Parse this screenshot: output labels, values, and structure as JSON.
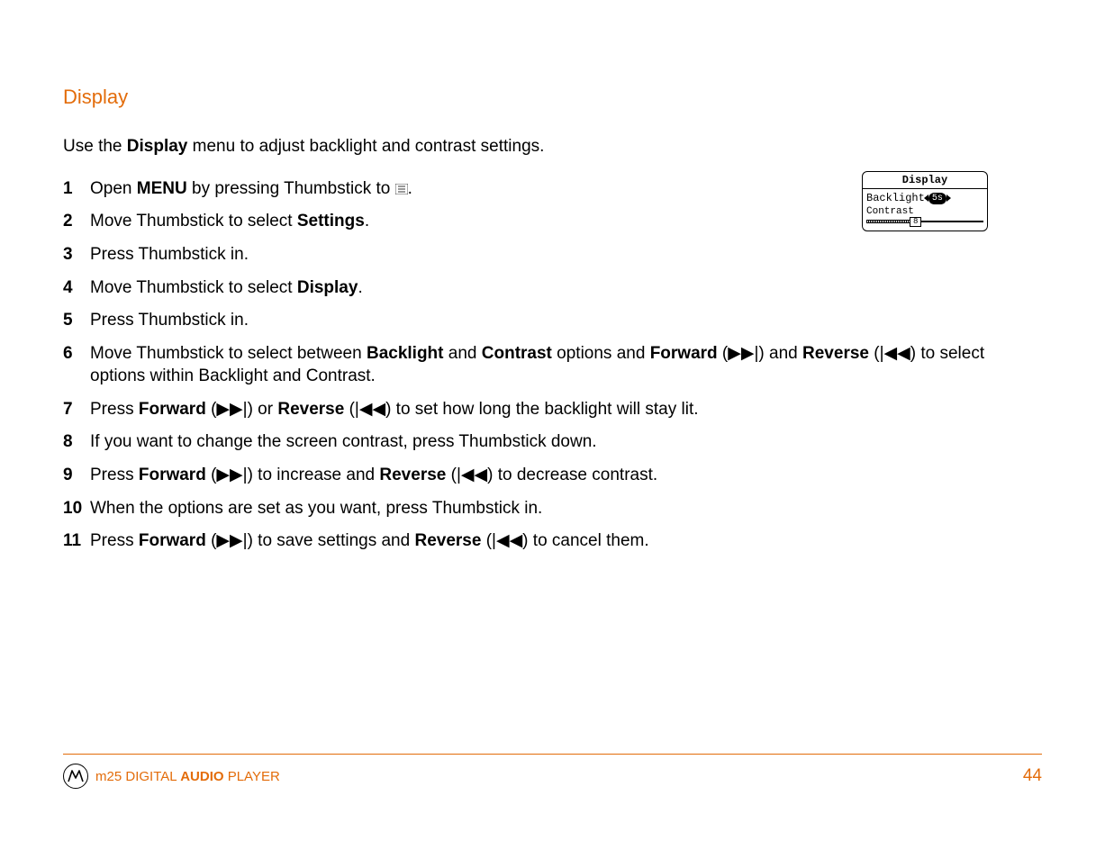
{
  "heading": "Display",
  "intro": {
    "pre": "Use the ",
    "bold": "Display",
    "post": " menu to adjust backlight and contrast settings."
  },
  "steps": [
    {
      "n": "1",
      "parts": [
        "Open ",
        {
          "b": "MENU"
        },
        " by pressing Thumbstick to ",
        {
          "icon": "menu"
        },
        "."
      ]
    },
    {
      "n": "2",
      "parts": [
        "Move Thumbstick to select ",
        {
          "b": "Settings"
        },
        "."
      ]
    },
    {
      "n": "3",
      "parts": [
        "Press Thumbstick in."
      ]
    },
    {
      "n": "4",
      "parts": [
        "Move Thumbstick to select ",
        {
          "b": "Display"
        },
        "."
      ]
    },
    {
      "n": "5",
      "parts": [
        "Press Thumbstick in."
      ]
    },
    {
      "n": "6",
      "parts": [
        "Move Thumbstick to select between ",
        {
          "b": "Backlight"
        },
        " and ",
        {
          "b": "Contrast"
        },
        " options and ",
        {
          "b": "Forward"
        },
        " (▶▶|) and ",
        {
          "b": "Reverse"
        },
        " (|◀◀) to select options within Backlight and Contrast."
      ]
    },
    {
      "n": "7",
      "parts": [
        "Press ",
        {
          "b": "Forward"
        },
        " (▶▶|) or ",
        {
          "b": "Reverse"
        },
        " (|◀◀) to set how long the backlight will stay lit."
      ]
    },
    {
      "n": "8",
      "parts": [
        "If you want to change the screen contrast, press Thumbstick down."
      ]
    },
    {
      "n": "9",
      "parts": [
        "Press ",
        {
          "b": "Forward"
        },
        " (▶▶|) to increase and ",
        {
          "b": "Reverse"
        },
        " (|◀◀) to decrease contrast."
      ]
    },
    {
      "n": "10",
      "parts": [
        "When the options are set as you want, press Thumbstick in."
      ]
    },
    {
      "n": "11",
      "parts": [
        "Press ",
        {
          "b": "Forward"
        },
        " (▶▶|) to save settings and ",
        {
          "b": "Reverse"
        },
        " (|◀◀) to cancel them."
      ]
    }
  ],
  "mini": {
    "title": "Display",
    "backlight_label": "Backlight",
    "backlight_value": "5s",
    "contrast_label": "Contrast",
    "contrast_value": "8"
  },
  "footer": {
    "model": "m25",
    "mid": " DIGITAL ",
    "audio": "AUDIO",
    "tail": " PLAYER",
    "page": "44"
  }
}
